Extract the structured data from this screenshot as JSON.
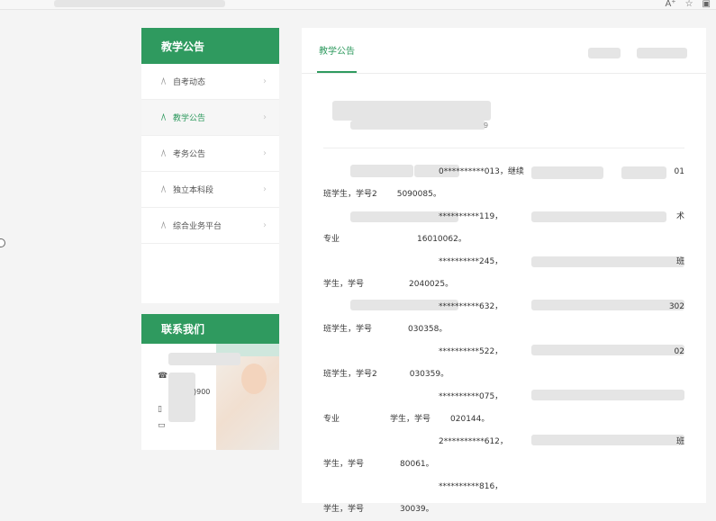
{
  "browser": {
    "icons": [
      "A⁺",
      "☆",
      "▣"
    ]
  },
  "sidebar": {
    "title": "教学公告",
    "items": [
      {
        "label": "自考动态"
      },
      {
        "label": "教学公告"
      },
      {
        "label": "考务公告"
      },
      {
        "label": "独立本科段"
      },
      {
        "label": "综合业务平台"
      }
    ],
    "item_icon": "/\\",
    "chevron": "›"
  },
  "contact": {
    "title": "联系我们",
    "phone_fragment": ")900"
  },
  "main": {
    "tab_label": "教学公告",
    "date_fragment": "9",
    "lines": [
      {
        "text": "0**********013，继续",
        "right": "01"
      },
      {
        "text": "班学生，学号2",
        "suffix": "5090085。"
      },
      {
        "text": "**********119，",
        "right": "术"
      },
      {
        "text": "专业",
        "suffix": "16010062。"
      },
      {
        "text": "**********245，",
        "right": "班"
      },
      {
        "text": "学生，学号",
        "suffix": "2040025。"
      },
      {
        "text": "**********632，",
        "right": "302"
      },
      {
        "text": "班学生，学号",
        "suffix": "030358。"
      },
      {
        "text": "**********522，",
        "right": "02"
      },
      {
        "text": "班学生，学号2",
        "suffix": "030359。"
      },
      {
        "text": "**********075，",
        "right": ""
      },
      {
        "text": "专业",
        "suffix": "学生，学号",
        "suffix2": "020144。"
      },
      {
        "text": "2**********612，",
        "right": "班"
      },
      {
        "text": "学生，学号",
        "suffix": "80061。"
      },
      {
        "text": "**********816，",
        "right": ""
      },
      {
        "text": "学生，学号",
        "suffix": "30039。"
      }
    ]
  },
  "colors": {
    "brand_green": "#2f9a5f"
  }
}
